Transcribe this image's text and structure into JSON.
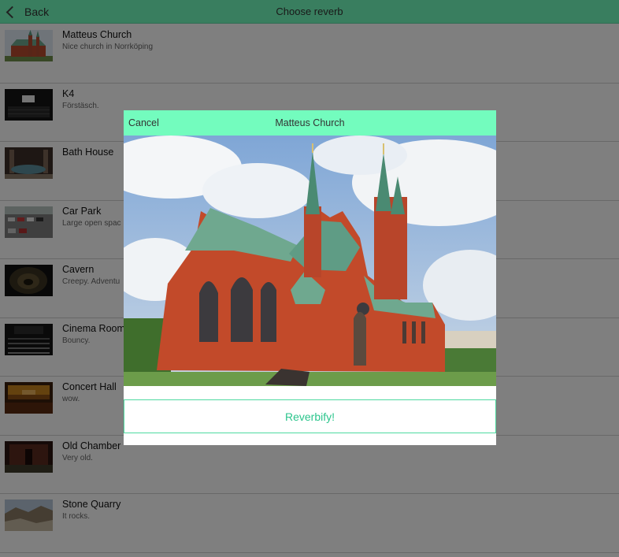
{
  "navbar": {
    "back_label": "Back",
    "title": "Choose reverb",
    "back_icon": "chevron-left-icon"
  },
  "reverbs": [
    {
      "title": "Matteus Church",
      "description": "Nice church in Norrköping"
    },
    {
      "title": "K4",
      "description": "Förstäsch."
    },
    {
      "title": "Bath House",
      "description": ""
    },
    {
      "title": "Car Park",
      "description": "Large open spac"
    },
    {
      "title": "Cavern",
      "description": "Creepy. Adventu"
    },
    {
      "title": "Cinema Room",
      "description": "Bouncy."
    },
    {
      "title": "Concert Hall",
      "description": "wow."
    },
    {
      "title": "Old Chamber",
      "description": "Very old."
    },
    {
      "title": "Stone Quarry",
      "description": "It rocks."
    }
  ],
  "modal": {
    "cancel_label": "Cancel",
    "title": "Matteus Church",
    "action_label": "Reverbify!"
  },
  "colors": {
    "accent": "#73fcbe",
    "button_text": "#2bc58c",
    "button_border": "#4fdaa0"
  }
}
